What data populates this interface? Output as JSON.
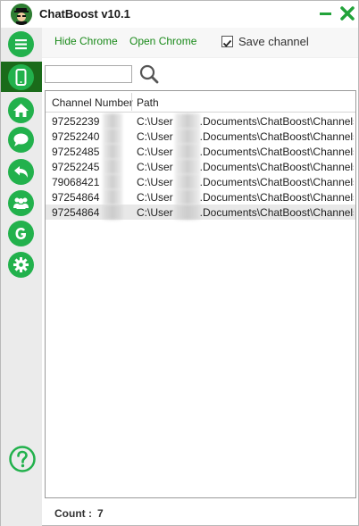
{
  "app": {
    "title": "ChatBoost  v10.1"
  },
  "colors": {
    "accent": "#22b14c",
    "active_nav": "#1a6b1a",
    "link": "#1a8a1a"
  },
  "sidebar": {
    "items": [
      {
        "icon": "menu-icon"
      },
      {
        "icon": "phone-icon",
        "active": true
      },
      {
        "icon": "home-icon"
      },
      {
        "icon": "chat-icon"
      },
      {
        "icon": "reply-icon"
      },
      {
        "icon": "users-icon"
      },
      {
        "icon": "g-icon"
      },
      {
        "icon": "gear-icon"
      }
    ],
    "help_icon": "help-icon"
  },
  "toolbar": {
    "hide_chrome": "Hide Chrome",
    "open_chrome": "Open Chrome",
    "save_channel": "Save channel",
    "save_channel_checked": true
  },
  "search": {
    "value": "",
    "placeholder": ""
  },
  "table": {
    "columns": [
      "Channel Number",
      "Path"
    ],
    "rows": [
      {
        "number": "97252239",
        "path_start": "C:\\User",
        "path_end": ".Documents\\ChatBoost\\Channels..."
      },
      {
        "number": "97252240",
        "path_start": "C:\\User",
        "path_end": ".Documents\\ChatBoost\\Channels..."
      },
      {
        "number": "97252485",
        "path_start": "C:\\User",
        "path_end": ".Documents\\ChatBoost\\Channels..."
      },
      {
        "number": "97252245",
        "path_start": "C:\\User",
        "path_end": ".Documents\\ChatBoost\\Channels..."
      },
      {
        "number": "79068421",
        "path_start": "C:\\User",
        "path_end": ".Documents\\ChatBoost\\Channels..."
      },
      {
        "number": "97254864",
        "path_start": "C:\\User",
        "path_end": ".Documents\\ChatBoost\\Channels..."
      },
      {
        "number": "97254864",
        "path_start": "C:\\User",
        "path_end": ".Documents\\ChatBoost\\Channels...",
        "selected": true
      }
    ]
  },
  "footer": {
    "count_label": "Count  :",
    "count_value": "7"
  }
}
